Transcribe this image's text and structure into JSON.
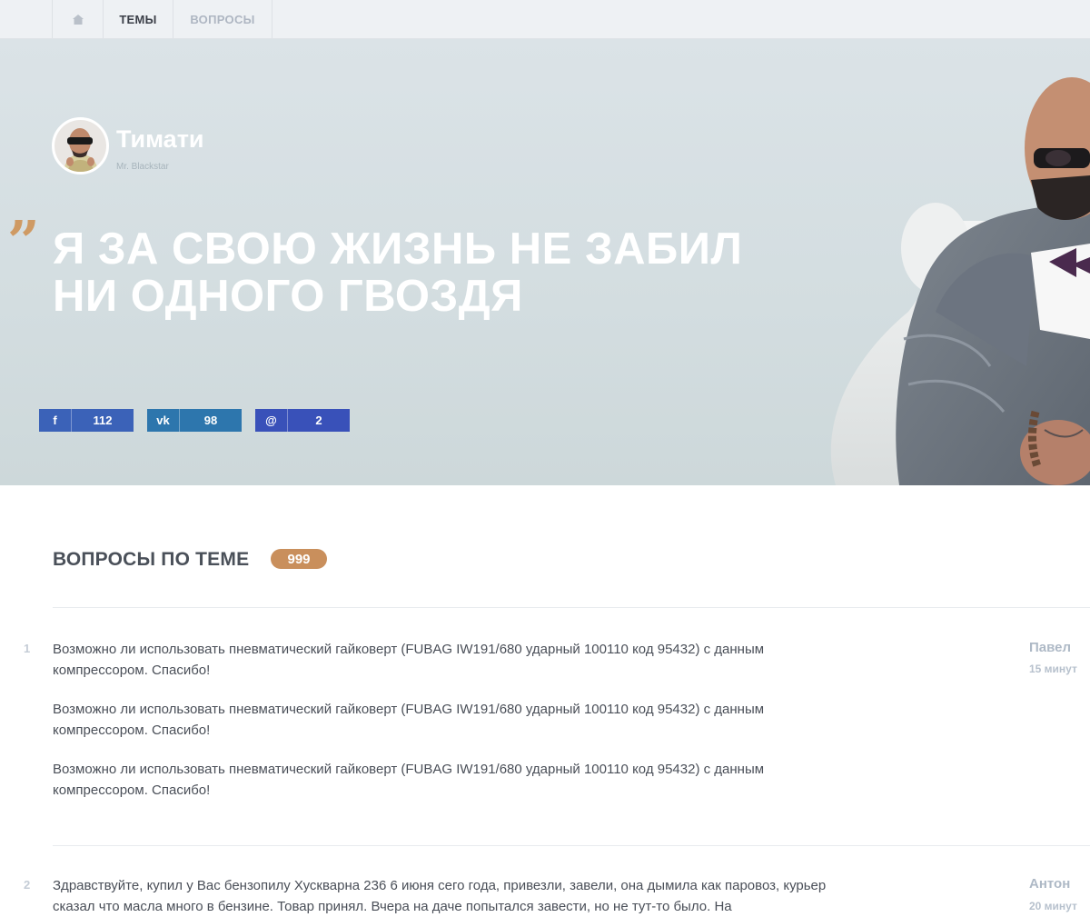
{
  "nav": {
    "home_icon": "home-icon",
    "topics_label": "ТЕМЫ",
    "questions_label": "ВОПРОСЫ"
  },
  "hero": {
    "author_name": "Тимати",
    "author_subtitle": "Mr. Blackstar",
    "quote_mark": "”",
    "quote": "Я ЗА СВОЮ ЖИЗНЬ НЕ ЗАБИЛ НИ ОДНОГО ГВОЗДЯ",
    "share": [
      {
        "network": "facebook",
        "icon": "f",
        "count": "112",
        "color": "#3b62b8"
      },
      {
        "network": "vkontakte",
        "icon": "vk",
        "count": "98",
        "color": "#2d76ad"
      },
      {
        "network": "email",
        "icon": "@",
        "count": "2",
        "color": "#3951b9"
      }
    ]
  },
  "questions": {
    "title": "ВОПРОСЫ ПО ТЕМЕ",
    "count": "999",
    "items": [
      {
        "number": "1",
        "paragraphs": [
          "Возможно ли использовать пневматический гайковерт (FUBAG IW191/680 ударный 100110 код 95432) с данным компрессором. Спасибо!",
          "Возможно ли использовать пневматический гайковерт (FUBAG IW191/680 ударный 100110 код 95432) с данным компрессором. Спасибо!",
          "Возможно ли использовать пневматический гайковерт (FUBAG IW191/680 ударный 100110 код 95432) с данным компрессором. Спасибо!"
        ],
        "author": "Павел",
        "time": "15 минут"
      },
      {
        "number": "2",
        "paragraphs": [
          "Здравствуйте, купил у Вас бензопилу Хускварна 236 6 июня сего года, привезли, завели, она дымила как паровоз, курьер сказал что масла много в бензине. Товар принял. Вчера на даче попытался завести, но не тут-то было. На"
        ],
        "author": "Антон",
        "time": "20 минут"
      }
    ]
  },
  "colors": {
    "accent": "#c98f5c",
    "facebook": "#3b62b8",
    "vkontakte": "#2d76ad",
    "email": "#3951b9"
  }
}
